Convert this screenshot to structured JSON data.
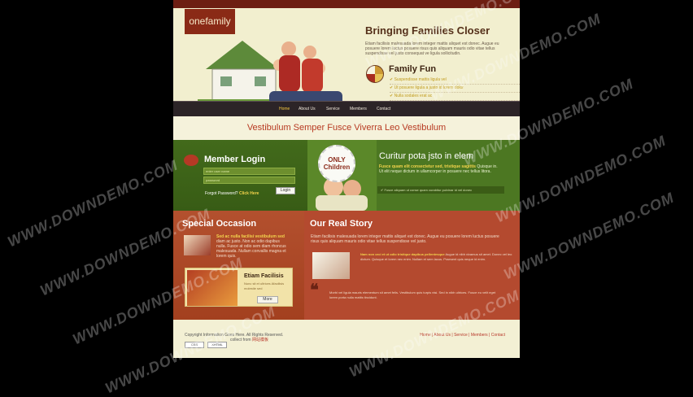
{
  "site": {
    "logo": "onefamily"
  },
  "hero": {
    "title": "Bringing Families Closer",
    "subtitle": "Etiam facilisis malesuada lorem integer mattis aliquet est donec. Augue eu posuere lorem luctus posuere risus quis aliquam mauris odio vitae tellus suspendisse vel justo consequat ve ligula sollicitudin.",
    "family_fun_title": "Family Fun",
    "family_fun_items": [
      "Suspendisse mattis ligula vel",
      "Ut posuere ligula a justo id lorem dolor",
      "Nulla sodales erat ac"
    ]
  },
  "nav": {
    "items": [
      "Home",
      "About Us",
      "Service",
      "Members",
      "Contact"
    ]
  },
  "banner": {
    "text": "Vestibulum Semper Fusce Viverra Leo Vestibulum"
  },
  "login": {
    "title": "Member Login",
    "username_placeholder": "enter user name",
    "password_placeholder": "password",
    "forgot_text": "Forgot Password?",
    "forgot_link": "Click Here",
    "login_button": "Login"
  },
  "badge": {
    "line1": "ONLY",
    "line2": "Children"
  },
  "curitur": {
    "title": "Curitur pota jsto in elem",
    "text_highlight": "Fusce quam elit consectetur sed, tristique sagittis",
    "text": "Quisque in. Ut elit neque dictum in ullamcorper in posuere nec tellus litora.",
    "checklist": "Fusce aliquam ut conse quam curabitur pulvinar id vel donec"
  },
  "special": {
    "title": "Special Occasion",
    "text_highlight": "Sed ac nulla facilisi vestibulum sed",
    "text": "diam ac justo. Non ac odio dapibus nulla. Fusce at odio sem diam rhoncus malesuada. Nullam convallis magna et lorem quis.",
    "card_title": "Etiam Facilisis",
    "card_text": "Nunc sit et ultrices Afacilisis molestie sed",
    "more_button": "More"
  },
  "story": {
    "title": "Our Real Story",
    "para1": "Etiam facilisis malesuada lorem integer mattis aliquet est donec. Augue eu posuere lorem luctus posuere risus quis aliquam mauris odio vitae tellus suspendisse vel justo.",
    "para2_highlight": "Nam non orci et ut odio tristique dapibus pellentesque",
    "para2": "Augue id nibh vivamus sit amet. Donec vel leo dictum. Quisque et lorem nec enim. Nullam et sem lacus. Praesent quis neque id enim.",
    "para3": "Morbi vel ligula mauris elementum sit amet felis. Vestibulum quis turpis nisi. Sed in nibh ultrices. Fusce eu velit eget lorem porta nulla mattis tincidunt."
  },
  "footer": {
    "copyright": "Copyright Information Goes Here. All Rights Reserved.",
    "collect_from": "collect from",
    "collect_link": "网站模板",
    "badge_css": "CSS",
    "badge_xhtml": "XHTML",
    "links": [
      "Home",
      "About Us",
      "Service",
      "Members",
      "Contact"
    ]
  },
  "watermark": "WWW.DOWNDEMO.COM",
  "colors": {
    "header_dark": "#6d1e12",
    "nav": "#2c2427",
    "green": "#4c7722",
    "red": "#b44a2f",
    "cream": "#f3efcf",
    "accent": "#f4c83e"
  }
}
